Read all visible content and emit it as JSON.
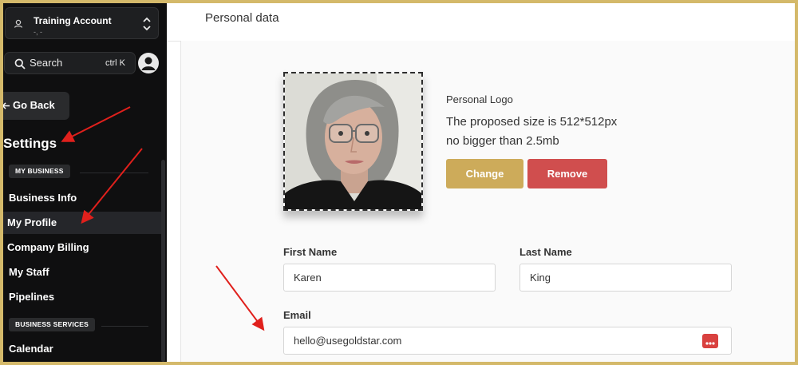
{
  "account": {
    "name": "Training Account",
    "sub": "-, -"
  },
  "search": {
    "label": "Search",
    "shortcut": "ctrl K"
  },
  "nav": {
    "back_label": "Go Back",
    "settings_title": "Settings",
    "sections": [
      {
        "label": "MY BUSINESS",
        "items": [
          "Business Info",
          "My Profile",
          "Company Billing",
          "My Staff",
          "Pipelines"
        ]
      },
      {
        "label": "BUSINESS SERVICES",
        "items": [
          "Calendar"
        ]
      }
    ],
    "active_item": "My Profile"
  },
  "page": {
    "title": "Personal data"
  },
  "logo": {
    "label": "Personal Logo",
    "size_text": "The proposed size is 512*512px",
    "limit_text": "no bigger than 2.5mb",
    "change_label": "Change",
    "remove_label": "Remove"
  },
  "form": {
    "first_name_label": "First Name",
    "first_name_value": "Karen",
    "last_name_label": "Last Name",
    "last_name_value": "King",
    "email_label": "Email",
    "email_value": "hello@usegoldstar.com"
  },
  "colors": {
    "brand_gold": "#cdab5a",
    "danger_red": "#d04e4e",
    "sidebar_bg": "#0f0f10",
    "annotation_red": "#e0201c"
  },
  "icons": [
    "location-pin-icon",
    "chevron-updown-icon",
    "search-icon",
    "user-avatar-icon",
    "arrow-left-icon",
    "dots-menu-icon"
  ]
}
